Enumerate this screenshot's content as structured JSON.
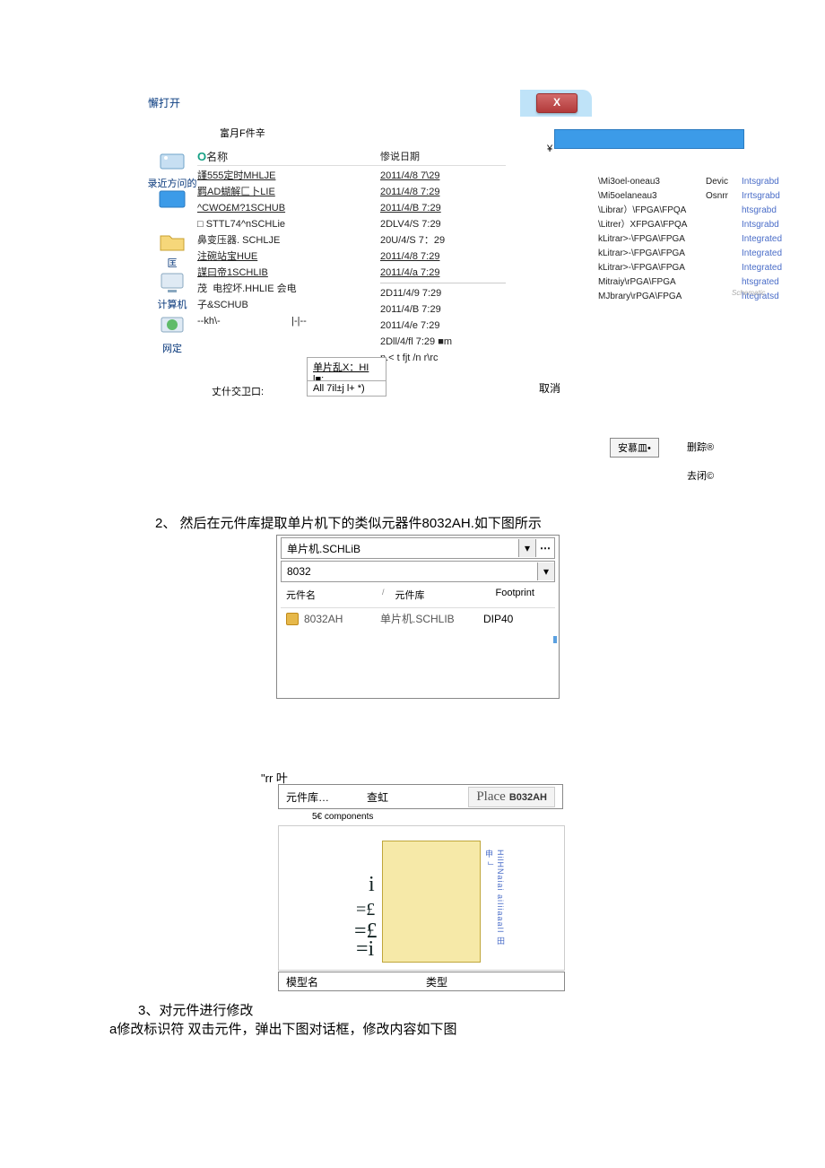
{
  "open_dialog": {
    "title": "懈打开",
    "subtitle": "富月F件辛",
    "close_glyph": "X",
    "yen": "¥",
    "places": {
      "recent": "录近方问的态",
      "desktop": "",
      "folder": "匡",
      "computer": "计算机",
      "network": "网定"
    },
    "list_header_name": "0名称",
    "list_header_date": "惨说日期",
    "files": [
      {
        "name": "謹555定时MHLJE",
        "date": "2011/4/8 7\\29",
        "u": true
      },
      {
        "name": "羁AD蝴解匚卜LIE",
        "date": "2011/4/8 7:29",
        "u": true
      },
      {
        "name": "^CWO£M?1SCHUB",
        "date": "2011/4/B 7:29",
        "u": true
      },
      {
        "name": "□ STTL74^nSCHLie",
        "date": "2DLV4/S 7:29"
      },
      {
        "name": "鼻变压器. SCHLJE",
        "date": "20U/4/S 7：29"
      },
      {
        "name": "注碗站宝HUE",
        "date": "2011/4/8 7:29",
        "u": true
      },
      {
        "name": "謀曰帝1SCHLIB",
        "date": "2011/4/a 7:29",
        "u": true
      },
      {
        "name": "",
        "date": "2D11/4/9    7:29",
        "sep": true
      },
      {
        "name": "茂  电控坏.HHLIE 会电",
        "date": "2011/4/B    7:29"
      },
      {
        "name": "子&SCHUB",
        "date": "2011/4/e    7:29"
      },
      {
        "name": "",
        "date": "2Dll/4/fl  7:29  ■m"
      },
      {
        "name": "--kh\\-                          |-|--",
        "date": "n.< t fjt /n r\\rc"
      }
    ],
    "combo1_label": "单片乱X：HI l■:",
    "open_label": "丈什交卫口:",
    "combo2_label": "All 7il±j l+ *)",
    "cancel": "取消"
  },
  "lib_list": [
    {
      "p": "\\Mi3oel-oneau3",
      "m": "Devic",
      "s": "Intsgrabd"
    },
    {
      "p": "\\Mi5oelaneau3",
      "m": "Osnrr",
      "s": "Irrtsgrabd"
    },
    {
      "p": "\\Librar）\\FPGA\\FPQA",
      "m": "",
      "s": "htsgrabd"
    },
    {
      "p": "\\Litrer）XFPGA\\FPQA",
      "m": "",
      "s": "Intsgrabd"
    },
    {
      "p": "kLitrar>-\\FPGA\\FPGA",
      "m": "",
      "s": "Integrated"
    },
    {
      "p": "kLitrar>-\\FPGA\\FPGA",
      "m": "",
      "s": "Integrated"
    },
    {
      "p": "kLitrar>-\\FPGA\\FPGA",
      "m": "",
      "s": "Integrated"
    },
    {
      "p": "Mitraiy\\rPGA\\FPGA",
      "m": "",
      "s": "htsgrated"
    },
    {
      "p": "MJbrary\\rPGA\\FPGA",
      "m": "",
      "s": "htegratsd"
    }
  ],
  "stamp": "Schematic",
  "buttons": {
    "install": "安慕皿•",
    "track": "删踪®",
    "close": "去闭©"
  },
  "step2": "2、  然后在元件库提取单片机下的类似元器件8032AH.如下图所示",
  "lib_panel": {
    "dropdown1": "单片机.SCHLiB",
    "dropdown2": "8032",
    "head": {
      "c1": "元件名",
      "c2": "元件库",
      "c3": "Footprint",
      "sort": "/"
    },
    "row": {
      "name": "8032AH",
      "lib": "单片机.SCHLIB",
      "fp": "DIP40"
    },
    "rr": "\"rr 叶",
    "actions": {
      "libs": "元件库…",
      "find": "查虹",
      "place": "Place",
      "part": "B032AH"
    },
    "count": "5€ components",
    "pins": {
      "p1": "i",
      "p2": "=£",
      "p3": "=£",
      "p4": "=i"
    },
    "vlabel": "HilHNaiai aiIiiaaaII 田 申 ┘",
    "model_row": {
      "c1": "模型名",
      "c2": "类型"
    }
  },
  "step3a": "3、对元件进行修改",
  "step3b": "a修改标识符 双击元件，弹出下图对话框，修改内容如下图"
}
